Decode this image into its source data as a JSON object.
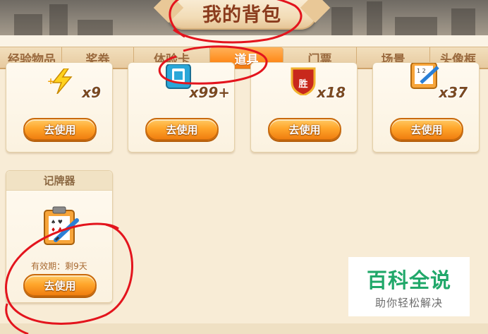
{
  "header": {
    "title": "我的背包"
  },
  "tabs": [
    {
      "label": "经验物品",
      "active": false
    },
    {
      "label": "奖券",
      "active": false
    },
    {
      "label": "体验卡",
      "active": false
    },
    {
      "label": "道具",
      "active": true
    },
    {
      "label": "门票",
      "active": false
    },
    {
      "label": "场景",
      "active": false
    },
    {
      "label": "头像框",
      "active": false
    }
  ],
  "items_row1": [
    {
      "icon": "lightning-icon",
      "quantity": "x9",
      "button": "去使用"
    },
    {
      "icon": "card-icon",
      "quantity": "x99+",
      "button": "去使用"
    },
    {
      "icon": "win-shield-icon",
      "icon_text": "胜",
      "quantity": "x18",
      "button": "去使用"
    },
    {
      "icon": "card-recorder-icon",
      "quantity": "x37",
      "button": "去使用"
    }
  ],
  "items_row2": [
    {
      "name": "记牌器",
      "icon": "card-recorder-icon",
      "validity": "有效期：剩9天",
      "button": "去使用"
    }
  ],
  "watermark": {
    "main": "百科全说",
    "sub": "助你轻松解决"
  },
  "colors": {
    "accent": "#ff8f22",
    "button": "#ffa62b",
    "annotation": "#e3141d",
    "watermark": "#21a86a"
  }
}
